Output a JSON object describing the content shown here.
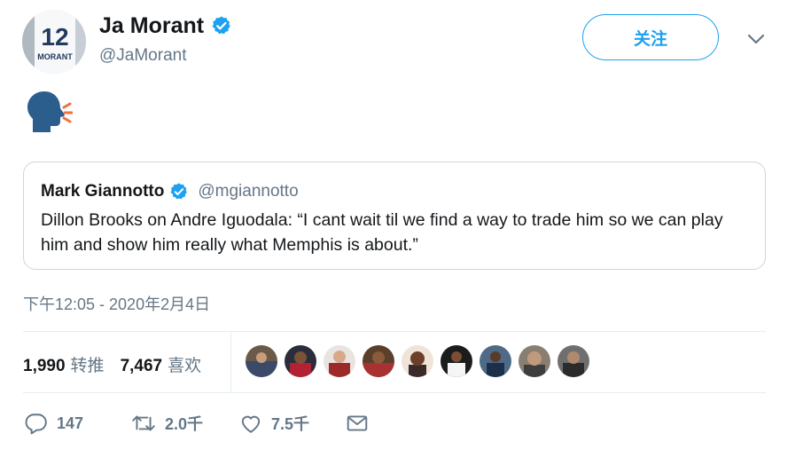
{
  "author": {
    "name": "Ja Morant",
    "handle": "@JaMorant",
    "verified": true,
    "jersey_number": "12",
    "jersey_name": "MORANT"
  },
  "follow_label": "关注",
  "tweet_emoji": "speaking-head-icon",
  "quoted": {
    "name": "Mark Giannotto",
    "handle": "@mgiannotto",
    "verified": true,
    "text": "Dillon Brooks on Andre Iguodala: “I cant wait til we find a way to trade him so we can play him and show him really what Memphis is about.”"
  },
  "timestamp": "下午12:05 - 2020年2月4日",
  "stats": {
    "retweets_count": "1,990",
    "retweets_label": "转推",
    "likes_count": "7,467",
    "likes_label": "喜欢"
  },
  "likers_count": 9,
  "actions": {
    "replies": "147",
    "retweets": "2.0千",
    "likes": "7.5千"
  },
  "colors": {
    "accent": "#1da1f2",
    "secondary_text": "#657786",
    "divider": "#e6ecf0"
  }
}
